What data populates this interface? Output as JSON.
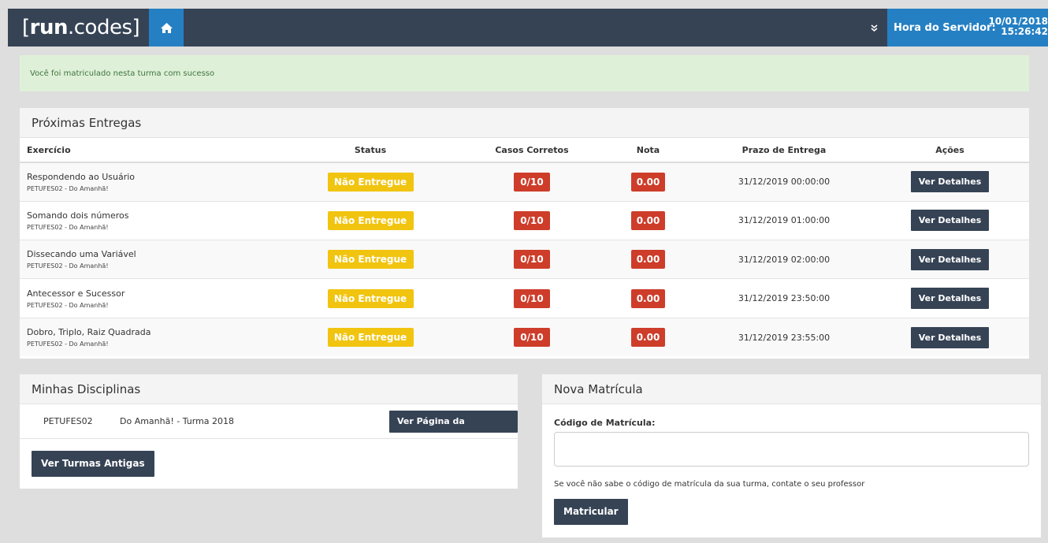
{
  "header": {
    "logo_bold": "run",
    "logo_rest": ".codes",
    "server_label": "Hora do Servidor:",
    "server_date": "10/01/2018",
    "server_time": "15:26:42"
  },
  "alert": {
    "message": "Você foi matriculado nesta turma com sucesso"
  },
  "entregas": {
    "title": "Próximas Entregas",
    "columns": [
      "Exercício",
      "Status",
      "Casos Corretos",
      "Nota",
      "Prazo de Entrega",
      "Ações"
    ],
    "rows": [
      {
        "name": "Respondendo ao Usuário",
        "sub": "PETUFES02 - Do Amanhã!",
        "status": "Não Entregue",
        "casos": "0/10",
        "nota": "0.00",
        "prazo": "31/12/2019 00:00:00",
        "action": "Ver Detalhes"
      },
      {
        "name": "Somando dois números",
        "sub": "PETUFES02 - Do Amanhã!",
        "status": "Não Entregue",
        "casos": "0/10",
        "nota": "0.00",
        "prazo": "31/12/2019 01:00:00",
        "action": "Ver Detalhes"
      },
      {
        "name": "Dissecando uma Variável",
        "sub": "PETUFES02 - Do Amanhã!",
        "status": "Não Entregue",
        "casos": "0/10",
        "nota": "0.00",
        "prazo": "31/12/2019 02:00:00",
        "action": "Ver Detalhes"
      },
      {
        "name": "Antecessor e Sucessor",
        "sub": "PETUFES02 - Do Amanhã!",
        "status": "Não Entregue",
        "casos": "0/10",
        "nota": "0.00",
        "prazo": "31/12/2019 23:50:00",
        "action": "Ver Detalhes"
      },
      {
        "name": "Dobro, Triplo, Raiz Quadrada",
        "sub": "PETUFES02 - Do Amanhã!",
        "status": "Não Entregue",
        "casos": "0/10",
        "nota": "0.00",
        "prazo": "31/12/2019 23:55:00",
        "action": "Ver Detalhes"
      }
    ]
  },
  "disciplinas": {
    "title": "Minhas Disciplinas",
    "items": [
      {
        "code": "PETUFES02",
        "name": "Do Amanhã! - Turma 2018",
        "action": "Ver Página da Disciplina"
      }
    ],
    "old_button": "Ver Turmas Antigas"
  },
  "nova": {
    "title": "Nova Matrícula",
    "label": "Código de Matrícula:",
    "input_value": "",
    "help": "Se você não sabe o código de matrícula da sua turma, contate o seu professor",
    "button": "Matricular"
  },
  "icons": {
    "home": "home-icon",
    "chevron": "double-chevron-down-icon"
  },
  "colors": {
    "navbar": "#364355",
    "accent": "#2580c3",
    "status_yellow": "#f1c40f",
    "badge_red": "#cd3d2a",
    "alert_bg": "#dff0d8",
    "alert_text": "#3c763d"
  }
}
